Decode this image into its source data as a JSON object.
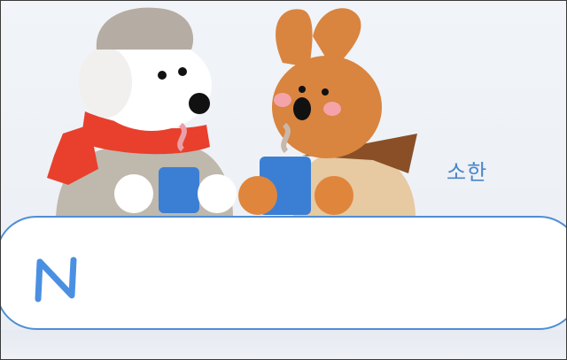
{
  "doodle": {
    "theme": "winter-friends",
    "label": "소한"
  },
  "search": {
    "logo_letter": "N",
    "value": "",
    "placeholder": ""
  },
  "colors": {
    "accent": "#4f8ed3",
    "label": "#4a86c8",
    "logo": "#4a90e2"
  }
}
